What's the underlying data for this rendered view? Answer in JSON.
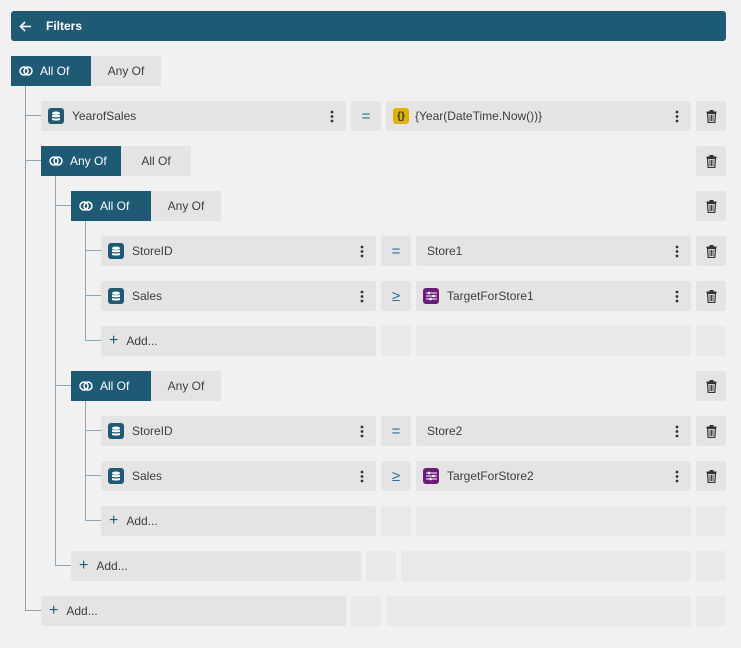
{
  "header": {
    "title": "Filters",
    "back_icon": "arrow-left-icon"
  },
  "groups": {
    "root": {
      "active": "All Of",
      "inactive": "Any Of"
    },
    "any": {
      "active": "Any Of",
      "inactive": "All Of"
    },
    "g1": {
      "active": "All Of",
      "inactive": "Any Of"
    },
    "g2": {
      "active": "All Of",
      "inactive": "Any Of"
    }
  },
  "rows": {
    "year": {
      "field": "YearofSales",
      "operator": "=",
      "value": "{Year(DateTime.Now())}"
    },
    "s1_id": {
      "field": "StoreID",
      "operator": "=",
      "value": "Store1"
    },
    "s1_sales": {
      "field": "Sales",
      "operator": "≥",
      "value": "TargetForStore1"
    },
    "s2_id": {
      "field": "StoreID",
      "operator": "=",
      "value": "Store2"
    },
    "s2_sales": {
      "field": "Sales",
      "operator": "≥",
      "value": "TargetForStore2"
    }
  },
  "add_label": "Add...",
  "icons": {
    "field": "database-icon",
    "expression": "curly-braces-icon",
    "parameter": "sliders-icon",
    "menu": "vertical-dots-icon",
    "delete": "trash-icon",
    "group": "intersect-circles-icon",
    "add": "plus-icon"
  },
  "colors": {
    "header": "#1f5a75",
    "active_toggle": "#1f5a75",
    "expression_icon": "#e0b300",
    "parameter_icon": "#6b1a7a",
    "operator": "#2a7096"
  }
}
